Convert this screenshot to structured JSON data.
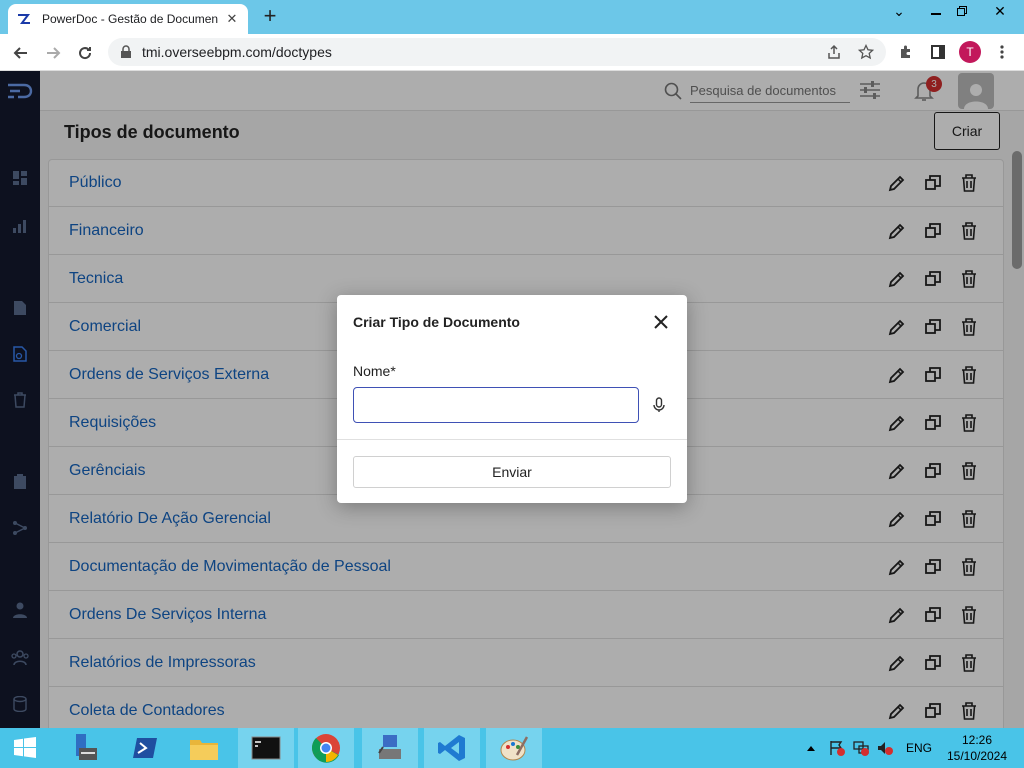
{
  "browser": {
    "tab_title": "PowerDoc - Gestão de Documen",
    "url": "tmi.overseebpm.com/doctypes",
    "profile_initial": "T"
  },
  "topbar": {
    "search_placeholder": "Pesquisa de documentos",
    "notifications_count": "3"
  },
  "page": {
    "title": "Tipos de documento",
    "create_label": "Criar"
  },
  "doctypes": [
    "Público",
    "Financeiro",
    "Tecnica",
    "Comercial",
    "Ordens de Serviços Externa",
    "Requisições",
    "Gerênciais",
    "Relatório De Ação Gerencial",
    "Documentação de Movimentação de Pessoal",
    "Ordens De Serviços Interna",
    "Relatórios de Impressoras",
    "Coleta de Contadores"
  ],
  "dialog": {
    "title": "Criar Tipo de Documento",
    "field_label": "Nome*",
    "field_value": "",
    "submit_label": "Enviar"
  },
  "taskbar": {
    "language": "ENG",
    "time": "12:26",
    "date": "15/10/2024"
  },
  "colors": {
    "link": "#1565c0",
    "sidebar": "#141a2e",
    "input_focus": "#3f51b5",
    "badge": "#d32f2f"
  }
}
